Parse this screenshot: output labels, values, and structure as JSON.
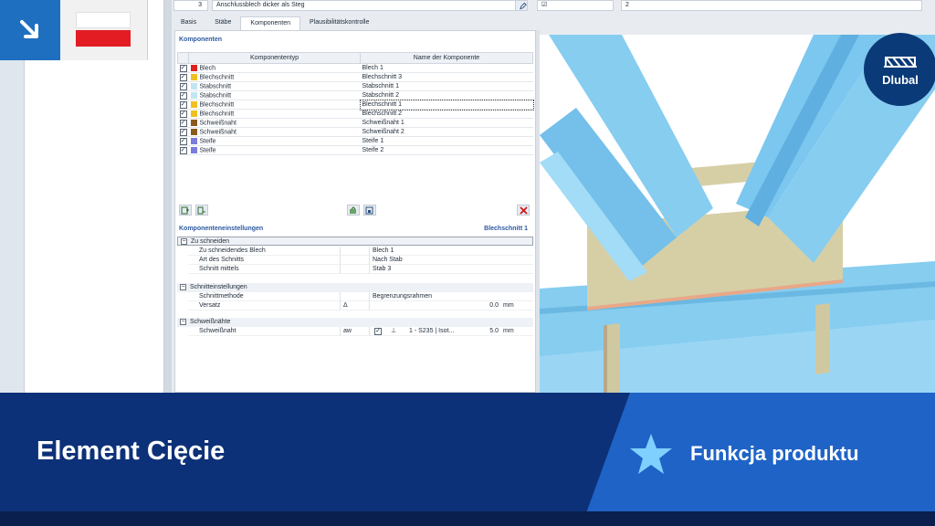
{
  "top_row": {
    "number": "3",
    "name": "Anschlussblech dicker als Steg",
    "check": "☑",
    "value": "2"
  },
  "tabs": [
    {
      "label": "Basis"
    },
    {
      "label": "Stäbe"
    },
    {
      "label": "Komponenten"
    },
    {
      "label": "Plausibilitätskontrolle"
    }
  ],
  "components": {
    "title": "Komponenten",
    "col_type": "Komponententyp",
    "col_name": "Name der Komponente",
    "rows": [
      {
        "type": "Blech",
        "name": "Blech 1",
        "color": "#e02020"
      },
      {
        "type": "Blechschnitt",
        "name": "Blechschnitt 3",
        "color": "#f0c020"
      },
      {
        "type": "Stabschnitt",
        "name": "Stabschnitt 1",
        "color": "#bfe6f2"
      },
      {
        "type": "Stabschnitt",
        "name": "Stabschnitt 2",
        "color": "#bfe6f2"
      },
      {
        "type": "Blechschnitt",
        "name": "Blechschnitt 1",
        "color": "#f0c020"
      },
      {
        "type": "Blechschnitt",
        "name": "Blechschnitt 2",
        "color": "#f0c020"
      },
      {
        "type": "Schweißnaht",
        "name": "Schweißnaht 1",
        "color": "#8a5a1e"
      },
      {
        "type": "Schweißnaht",
        "name": "Schweißnaht 2",
        "color": "#8a5a1e"
      },
      {
        "type": "Steife",
        "name": "Steife 1",
        "color": "#7b7be0"
      },
      {
        "type": "Steife",
        "name": "Steife 2",
        "color": "#7b7be0"
      }
    ]
  },
  "settings": {
    "title": "Komponenteneinstellungen",
    "selected": "Blechschnitt 1",
    "groups": {
      "cut": {
        "label": "Zu schneiden",
        "rows": [
          {
            "label": "Zu schneidendes Blech",
            "value": "Blech 1"
          },
          {
            "label": "Art des Schnitts",
            "value": "Nach Stab"
          },
          {
            "label": "Schnitt mittels",
            "value": "Stab 3"
          }
        ]
      },
      "cut_settings": {
        "label": "Schnitteinstellungen",
        "rows": [
          {
            "label": "Schnittmethode",
            "sym": "",
            "value": "Begrenzungsrahmen",
            "num": "",
            "unit": ""
          },
          {
            "label": "Versatz",
            "sym": "Δ",
            "value": "",
            "num": "0.0",
            "unit": "mm"
          }
        ]
      },
      "welds": {
        "label": "Schweißnähte",
        "rows": [
          {
            "label": "Schweißnaht",
            "sym": "aw",
            "value": "1 - S235 | Isot...",
            "num": "5.0",
            "unit": "mm"
          }
        ]
      }
    }
  },
  "brand": {
    "name": "Dlubal"
  },
  "banner": {
    "title": "Element Cięcie",
    "label": "Funkcja produktu"
  },
  "colors": {
    "banner_dark": "#0d3178",
    "banner_accent": "#1f63c6",
    "steel_blue": "#7cc7ef",
    "plate": "#d6cfa6"
  }
}
